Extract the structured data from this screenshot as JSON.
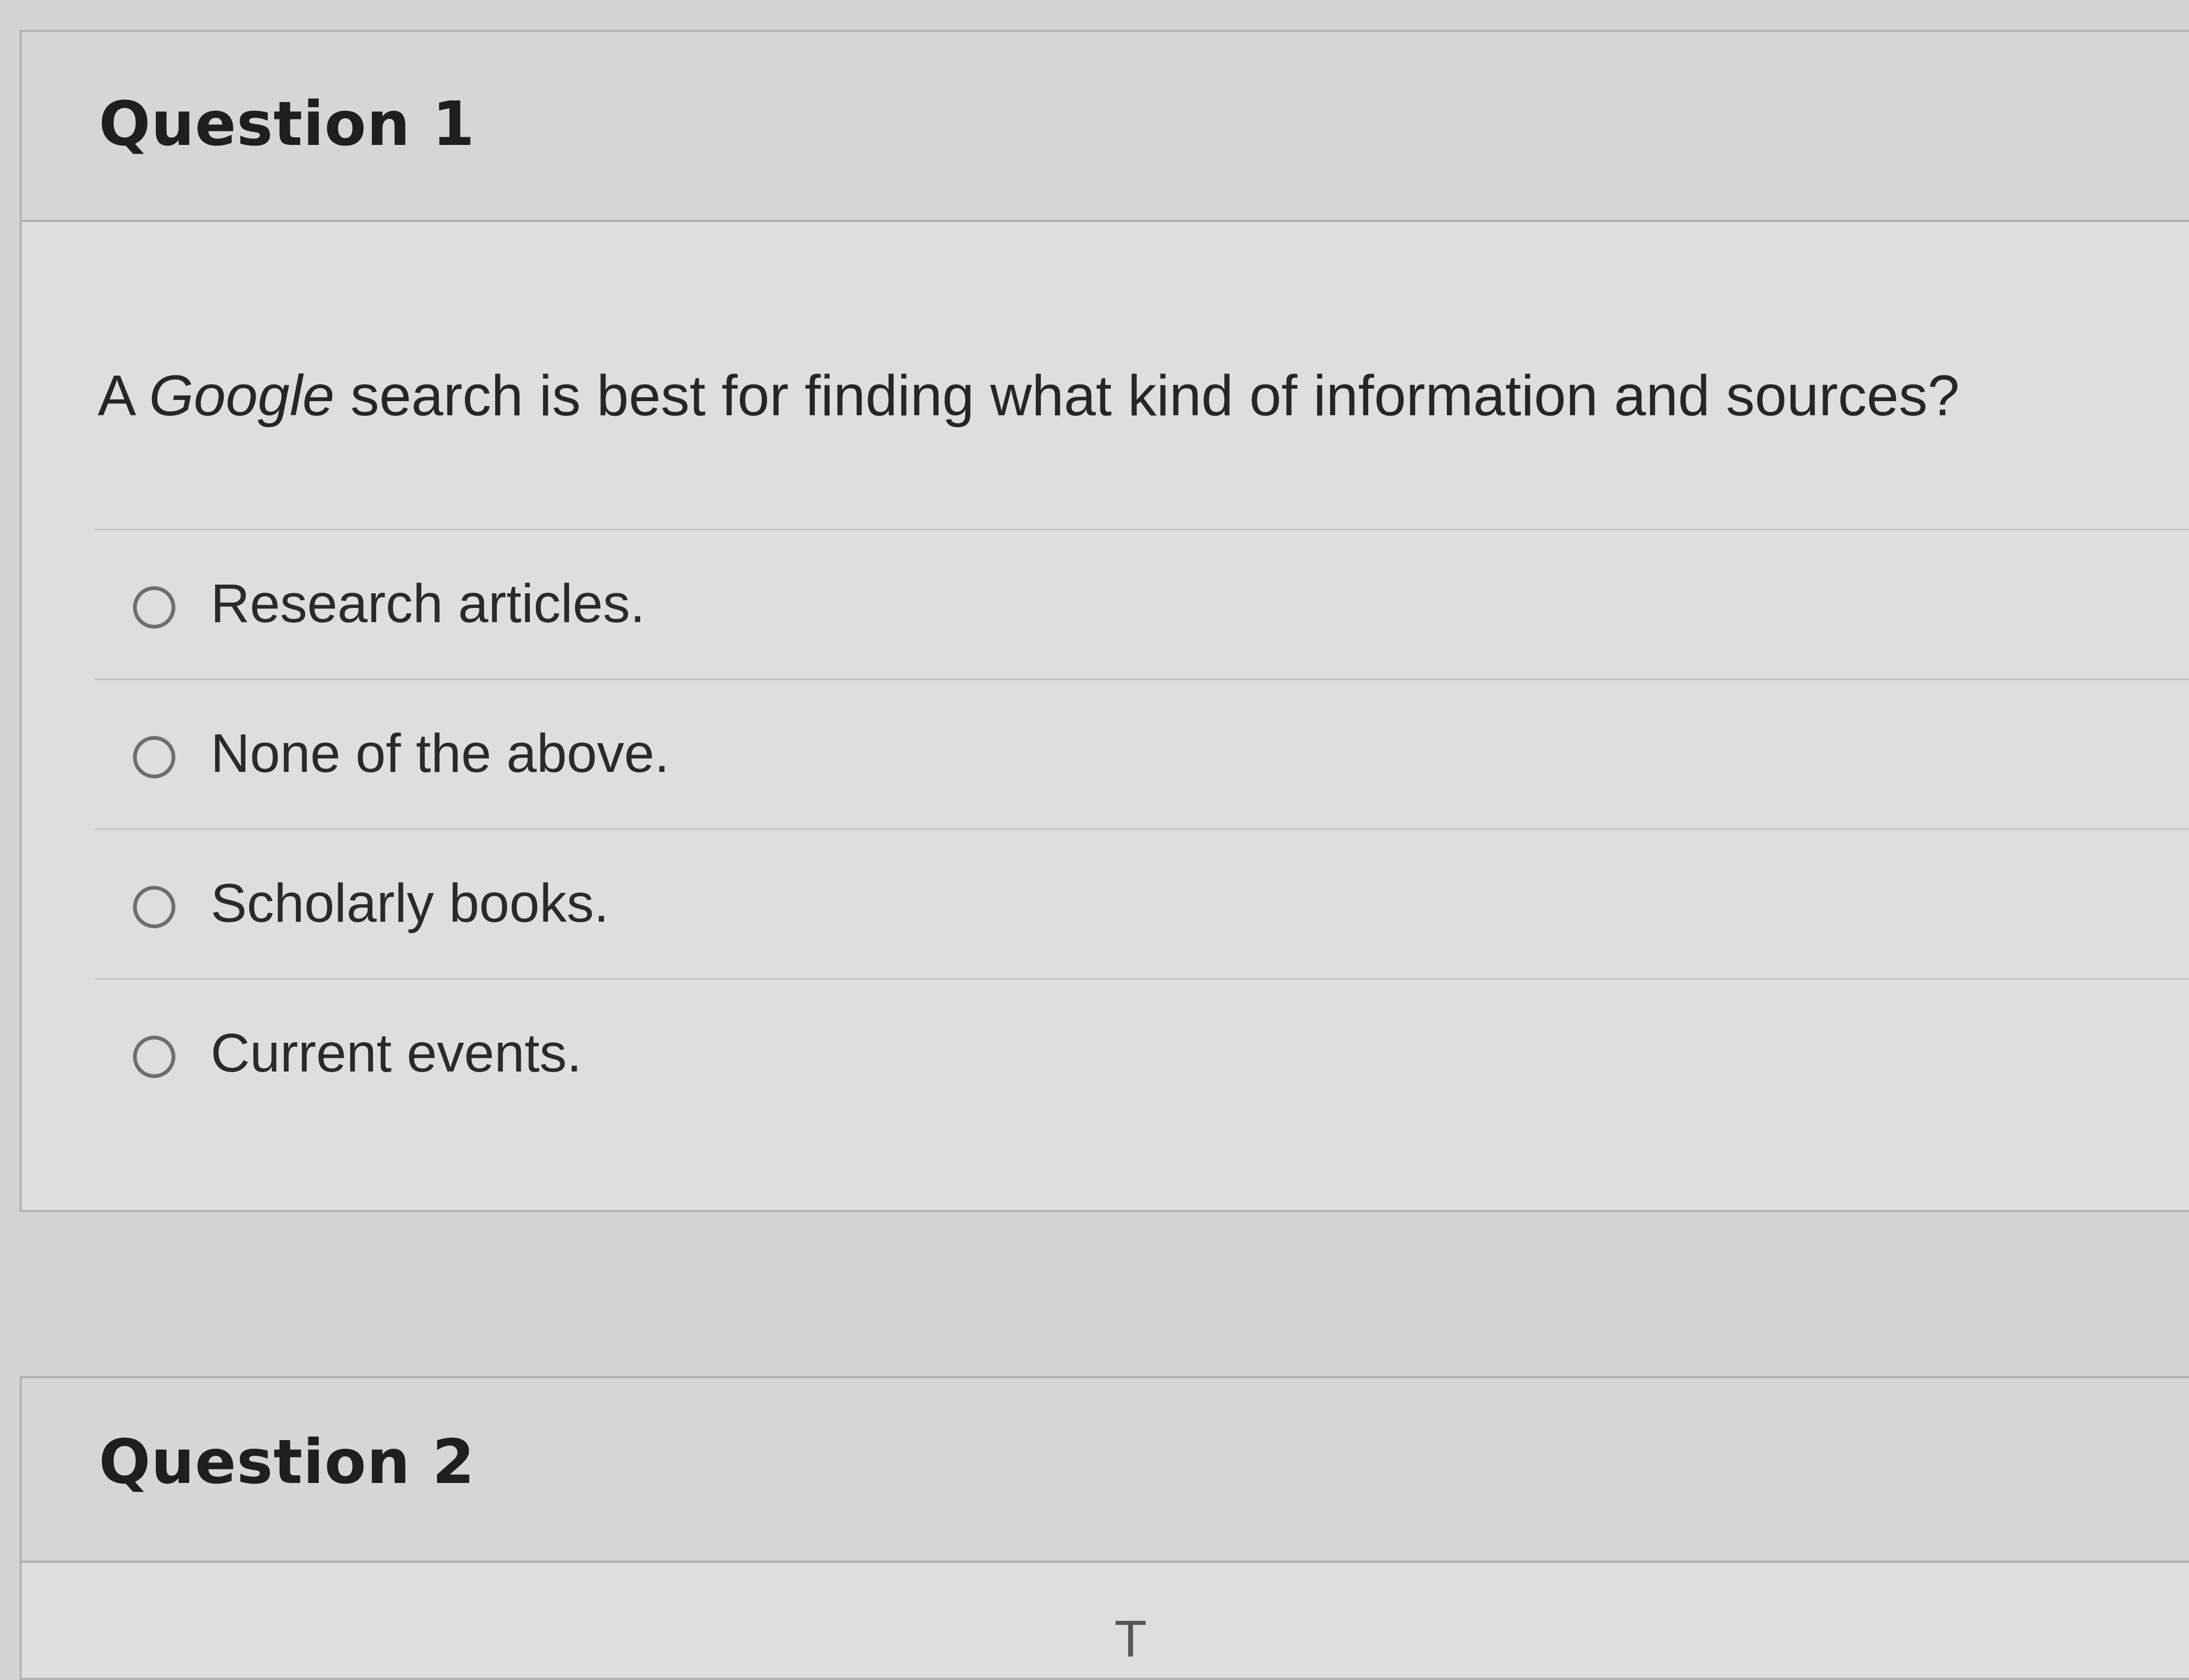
{
  "questions": [
    {
      "title": "Question 1",
      "prompt": {
        "before": "A ",
        "emphasis": "Google",
        "after": " search is best for finding what kind of information and sources?"
      },
      "answers": [
        "Research articles.",
        "None of the above.",
        "Scholarly books.",
        "Current events."
      ]
    },
    {
      "title": "Question 2"
    }
  ],
  "cursor": "T",
  "colors": {
    "page_background": "#d3d3d3",
    "card_background": "#dedede",
    "header_background": "#d6d6d6",
    "border": "#b3b3b3",
    "radio_border": "#6e6e6e"
  }
}
